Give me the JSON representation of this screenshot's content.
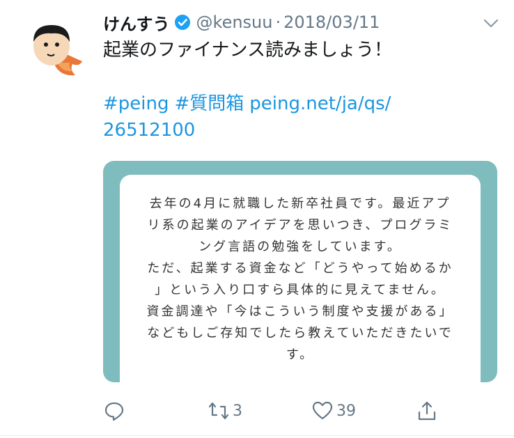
{
  "tweet": {
    "display_name": "けんすう",
    "handle": "@kensuu",
    "separator": "·",
    "date": "2018/03/11",
    "text": "起業のファイナンス読みましょう！",
    "tags": [
      "#peing",
      "#質問箱",
      "peing.net/ja/qs/",
      "26512100"
    ],
    "card_lines": [
      "去年の4月に就職した新卒社員です。最近アプ",
      "リ系の起業のアイデアを思いつき、プログラミ",
      "ング言語の勉強をしています。",
      "ただ、起業する資金など「どうやって始めるか",
      "」という入り口すら具体的に見えてません。",
      "資金調達や「今はこういう制度や支援がある」",
      "などもしご存知でしたら教えていただきたいで",
      "す。"
    ],
    "retweet_count": "3",
    "like_count": "39"
  },
  "colors": {
    "link": "#1b95e0",
    "verified": "#1da1f2",
    "muted": "#657786",
    "card_border": "#7fbcbd"
  },
  "icons": {
    "reply": "reply-icon",
    "retweet": "retweet-icon",
    "like": "heart-icon",
    "share": "share-icon",
    "more": "chevron-down-icon",
    "verified": "verified-badge-icon"
  }
}
